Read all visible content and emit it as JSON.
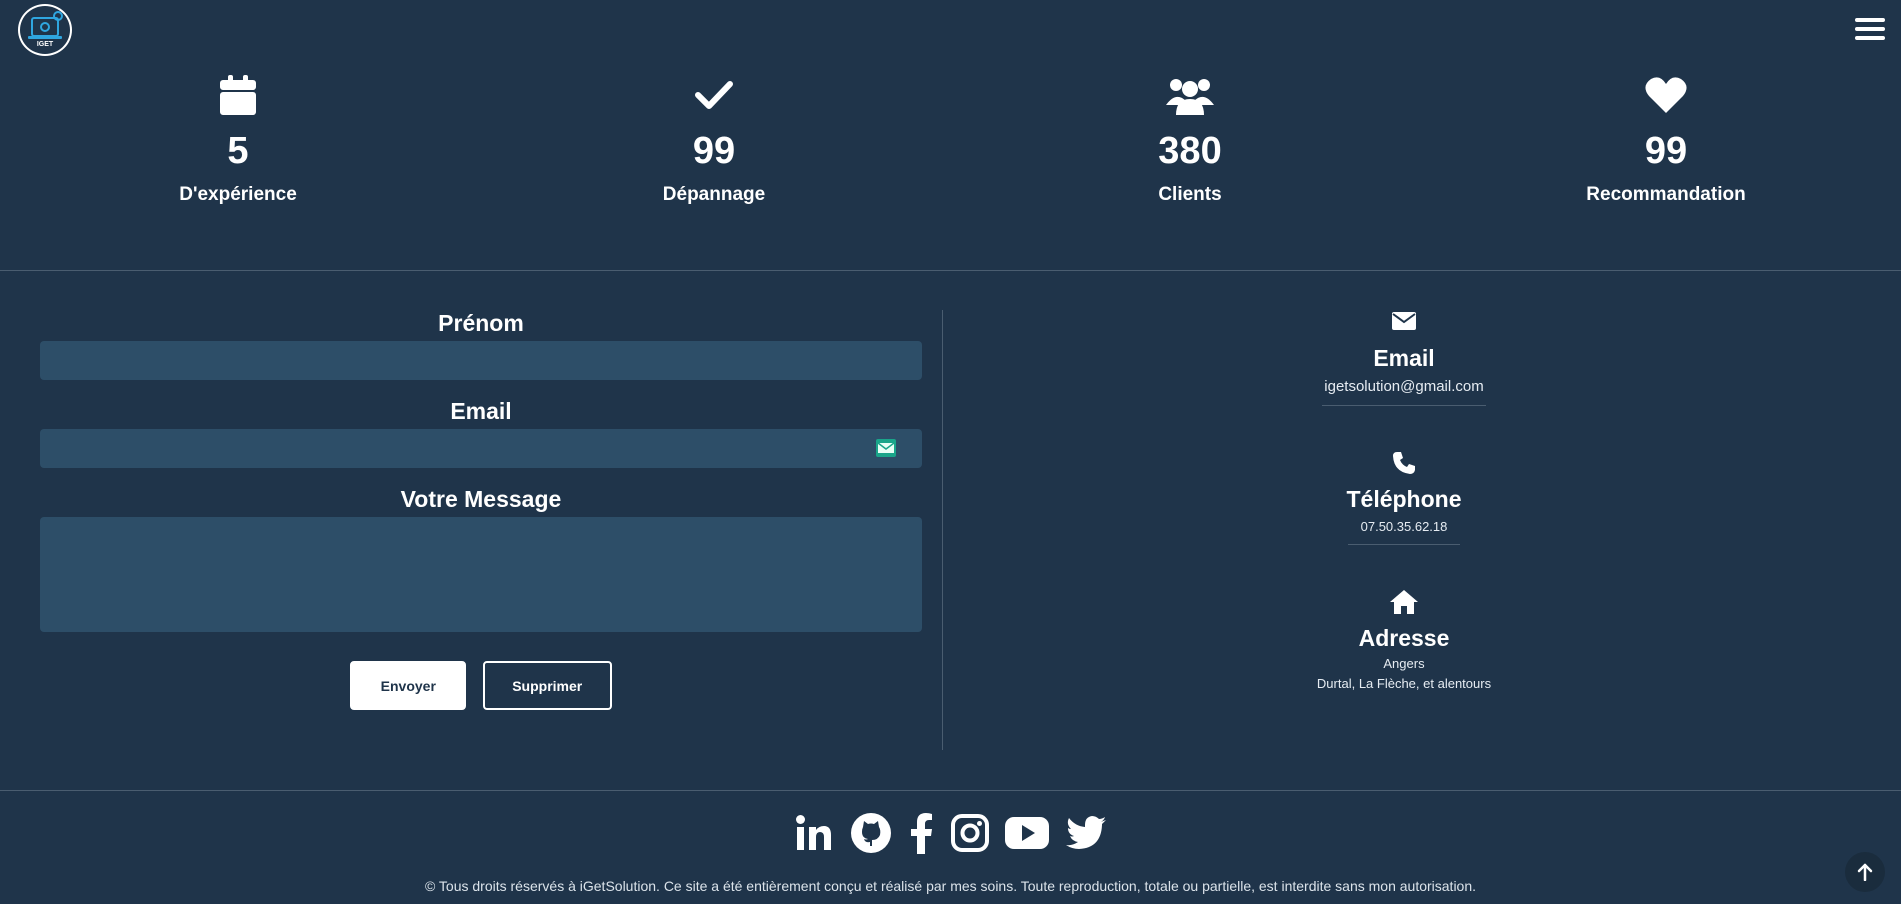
{
  "header": {
    "logo_text": "IGET",
    "menu_icon": "hamburger-icon"
  },
  "stats": [
    {
      "icon": "calendar-icon",
      "value": "5",
      "label": "D'expérience"
    },
    {
      "icon": "check-icon",
      "value": "99",
      "label": "Dépannage"
    },
    {
      "icon": "users-icon",
      "value": "380",
      "label": "Clients"
    },
    {
      "icon": "heart-icon",
      "value": "99",
      "label": "Recommandation"
    }
  ],
  "form": {
    "firstname_label": "Prénom",
    "firstname_value": "",
    "email_label": "Email",
    "email_value": "",
    "message_label": "Votre Message",
    "message_value": "",
    "send_label": "Envoyer",
    "clear_label": "Supprimer"
  },
  "contact": {
    "email": {
      "icon": "envelope-icon",
      "title": "Email",
      "value": "igetsolution@gmail.com"
    },
    "phone": {
      "icon": "phone-icon",
      "title": "Téléphone",
      "value": "07.50.35.62.18"
    },
    "address": {
      "icon": "home-icon",
      "title": "Adresse",
      "line1": "Angers",
      "line2": "Durtal, La Flèche, et alentours"
    }
  },
  "footer": {
    "socials": [
      "linkedin-icon",
      "github-icon",
      "facebook-icon",
      "instagram-icon",
      "youtube-icon",
      "twitter-icon"
    ],
    "copyright": "© Tous droits réservés à iGetSolution. Ce site a été entièrement conçu et réalisé par mes soins. Toute reproduction, totale ou partielle, est interdite sans mon autorisation."
  },
  "colors": {
    "background": "#1f344a",
    "input_background": "#2d4e68",
    "divider": "#4a5d70",
    "text": "#ffffff"
  }
}
